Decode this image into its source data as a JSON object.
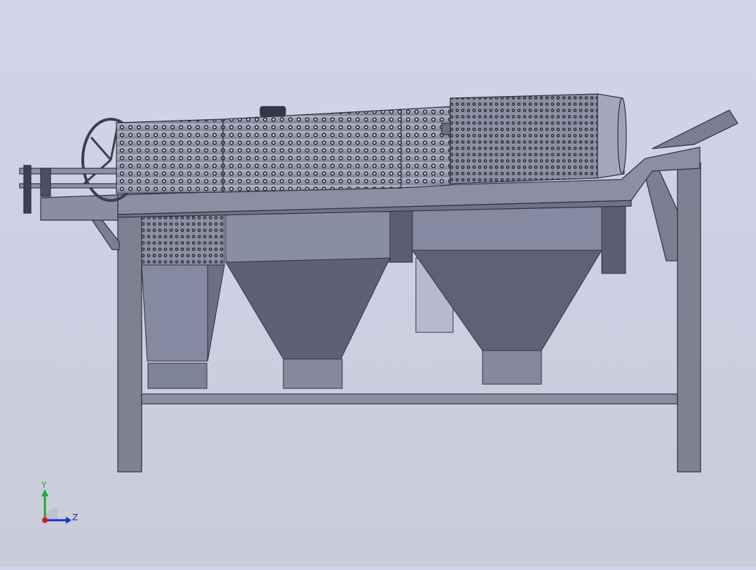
{
  "viewport": {
    "background_top": "#d2d4ea",
    "background_bottom": "#c9ccd8",
    "model": {
      "frame_color": "#7d8292",
      "frame_edge": "#2e3140",
      "drum_color": "#9a9eb0",
      "drum_hole_color": "#23252e",
      "hopper_light": "#868aa0",
      "hopper_dark": "#5f6274",
      "panel_light": "#b6b9cc"
    }
  },
  "triad": {
    "y_label": "Y",
    "z_label": "Z",
    "y_color": "#1faa2a",
    "z_color": "#1d2fd6",
    "x_color": "#d11a1a"
  }
}
